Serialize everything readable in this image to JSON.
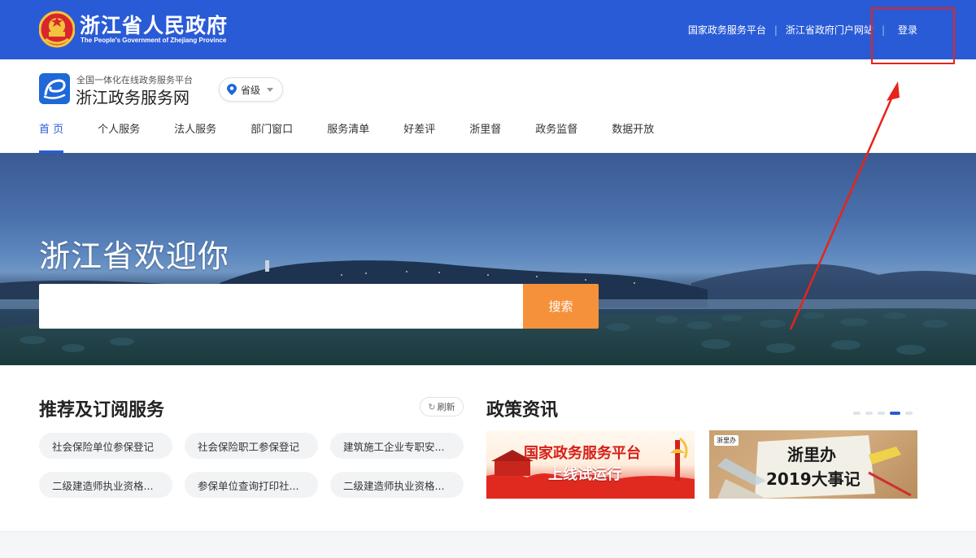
{
  "topbar": {
    "gov_title": "浙江省人民政府",
    "gov_subtitle": "The People's Government of Zhejiang Province",
    "links": [
      "国家政务服务平台",
      "浙江省政府门户网站"
    ],
    "separator": "|",
    "login": "登录",
    "bg_color": "#2a5bd7"
  },
  "site": {
    "subtitle": "全国一体化在线政务服务平台",
    "title": "浙江政务服务网",
    "region": "省级"
  },
  "nav": {
    "items": [
      "首 页",
      "个人服务",
      "法人服务",
      "部门窗口",
      "服务清单",
      "好差评",
      "浙里督",
      "政务监督",
      "数据开放"
    ],
    "active_index": 0
  },
  "hero": {
    "title": "浙江省欢迎你",
    "search_placeholder": "",
    "search_button": "搜索",
    "search_color": "#f6913b"
  },
  "recommend": {
    "title": "推荐及订阅服务",
    "refresh": "刷新",
    "tags": [
      "社会保险单位参保登记",
      "社会保险职工参保登记",
      "建筑施工企业专职安...",
      "二级建造师执业资格...",
      "参保单位查询打印社...",
      "二级建造师执业资格..."
    ]
  },
  "policy": {
    "title": "政策资讯",
    "carousel_dots": 5,
    "active_dot": 3,
    "cards": [
      {
        "line1": "国家政务服务平台",
        "line2": "上线试运行"
      },
      {
        "badge": "浙里办",
        "line1": "浙里办",
        "line2": "2019大事记"
      }
    ]
  },
  "annotation": {
    "color": "#e8231a"
  }
}
